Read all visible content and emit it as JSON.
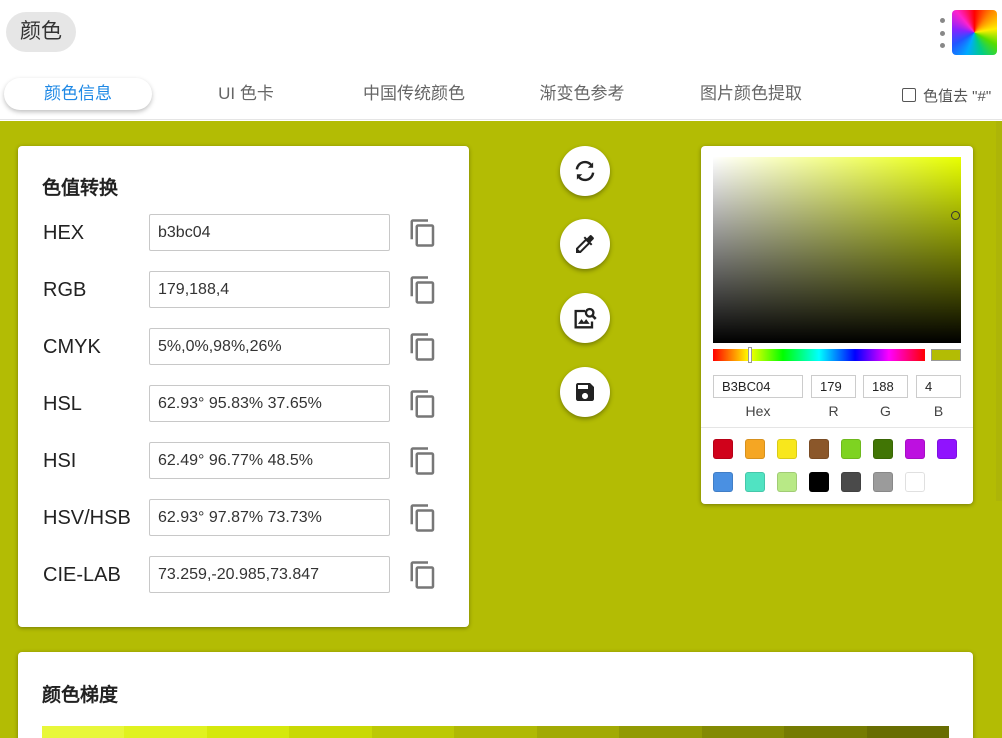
{
  "app": {
    "title": "颜色"
  },
  "tabs": [
    {
      "label": "颜色信息",
      "active": true
    },
    {
      "label": "UI 色卡"
    },
    {
      "label": "中国传统颜色"
    },
    {
      "label": "渐变色参考"
    },
    {
      "label": "图片颜色提取"
    }
  ],
  "hash_option": {
    "label": "色值去 \"#\"",
    "checked": false
  },
  "colors": {
    "background": "#b3bc04",
    "accent": "#1e88e5"
  },
  "conversion": {
    "title": "色值转换",
    "rows": [
      {
        "label": "HEX",
        "value": "b3bc04"
      },
      {
        "label": "RGB",
        "value": "179,188,4"
      },
      {
        "label": "CMYK",
        "value": "5%,0%,98%,26%"
      },
      {
        "label": "HSL",
        "value": "62.93° 95.83% 37.65%"
      },
      {
        "label": "HSI",
        "value": "62.49° 96.77% 48.5%"
      },
      {
        "label": "HSV/HSB",
        "value": "62.93° 97.87% 73.73%"
      },
      {
        "label": "CIE-LAB",
        "value": "73.259,-20.985,73.847"
      }
    ]
  },
  "actions": [
    {
      "name": "refresh-button",
      "icon": "refresh-icon"
    },
    {
      "name": "eyedropper-button",
      "icon": "eyedropper-icon"
    },
    {
      "name": "image-search-button",
      "icon": "image-search-icon"
    },
    {
      "name": "save-button",
      "icon": "save-icon"
    }
  ],
  "picker": {
    "hex": "B3BC04",
    "r": "179",
    "g": "188",
    "b": "4",
    "labels": {
      "hex": "Hex",
      "r": "R",
      "g": "G",
      "b": "B"
    },
    "presets": [
      "#d0021b",
      "#f5a623",
      "#f8e71c",
      "#8b572a",
      "#7ed321",
      "#417505",
      "#bd10e0",
      "#9013fe",
      "#4a90e2",
      "#50e3c2",
      "#b8e986",
      "#000000",
      "#4a4a4a",
      "#9b9b9b",
      "#ffffff"
    ]
  },
  "gradient": {
    "title": "颜色梯度",
    "steps": [
      "#e8f73a",
      "#e0f220",
      "#d5e80c",
      "#c9d905",
      "#bcc904",
      "#b0b904",
      "#a2aa04",
      "#929a03",
      "#838a03",
      "#757b02",
      "#686d02"
    ]
  }
}
